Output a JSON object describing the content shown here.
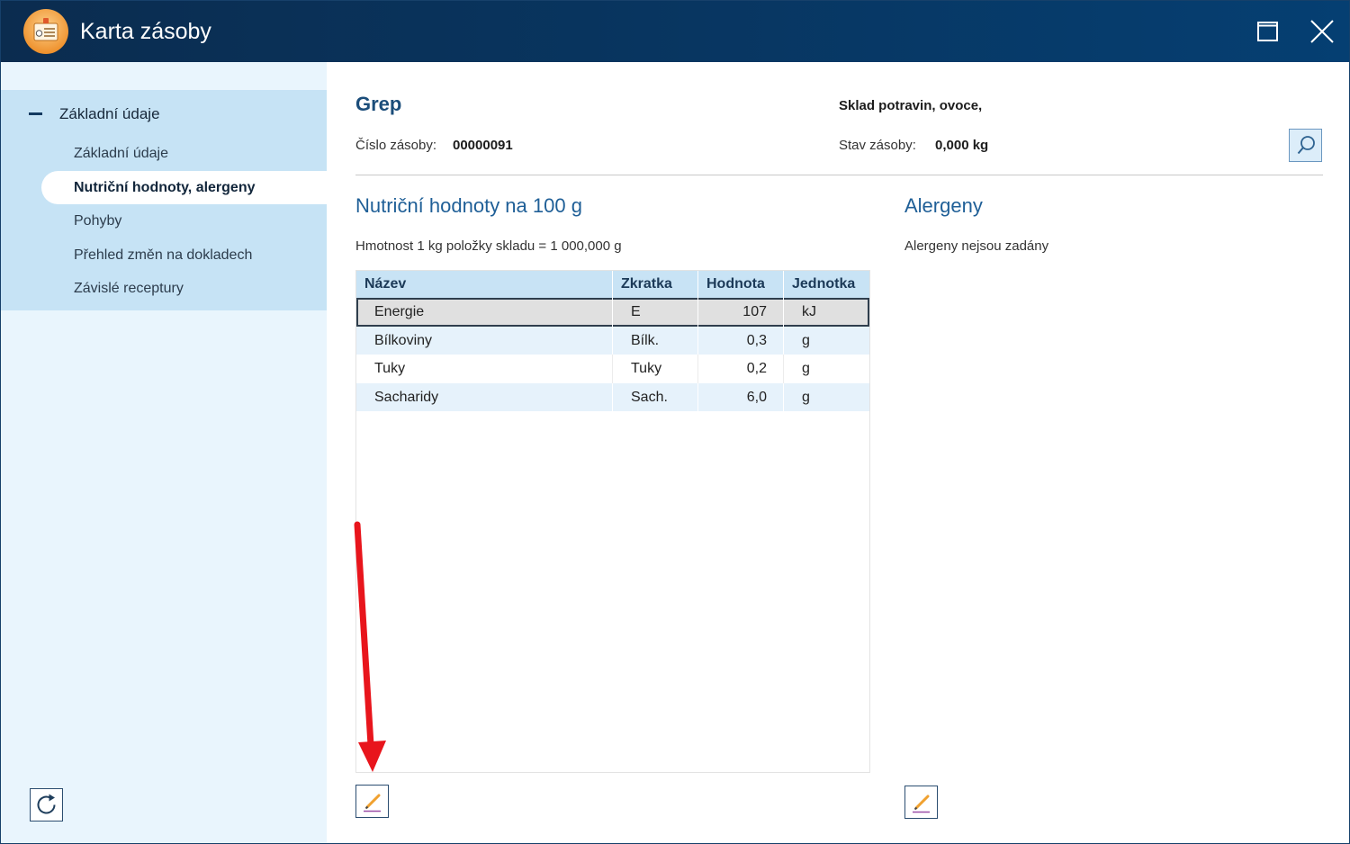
{
  "window": {
    "title": "Karta zásoby",
    "app_icon": "inventory-card-icon",
    "maximize_icon": "maximize-icon",
    "close_icon": "close-icon"
  },
  "sidebar": {
    "group": {
      "label": "Základní údaje",
      "toggle_icon": "minus-icon",
      "expanded": true
    },
    "items": [
      {
        "label": "Základní údaje"
      },
      {
        "label": "Nutriční hodnoty, alergeny",
        "selected": true
      },
      {
        "label": "Pohyby"
      },
      {
        "label": "Přehled změn na dokladech"
      },
      {
        "label": "Závislé receptury"
      }
    ],
    "refresh_icon": "refresh-icon"
  },
  "header": {
    "item_name": "Grep",
    "warehouse": "Sklad potravin, ovoce,",
    "stock_number_label": "Číslo zásoby:",
    "stock_number": "00000091",
    "stock_state_label": "Stav zásoby:",
    "stock_state": "0,000 kg",
    "search_icon": "search-icon"
  },
  "nutrition": {
    "title": "Nutriční hodnoty na 100 g",
    "weight_note": "Hmotnost 1 kg položky skladu = 1 000,000 g",
    "columns": [
      "Název",
      "Zkratka",
      "Hodnota",
      "Jednotka"
    ],
    "rows": [
      {
        "name": "Energie",
        "abbr": "E",
        "value": "107",
        "unit": "kJ",
        "selected": true
      },
      {
        "name": "Bílkoviny",
        "abbr": "Bílk.",
        "value": "0,3",
        "unit": "g"
      },
      {
        "name": "Tuky",
        "abbr": "Tuky",
        "value": "0,2",
        "unit": "g"
      },
      {
        "name": "Sacharidy",
        "abbr": "Sach.",
        "value": "6,0",
        "unit": "g"
      }
    ],
    "edit_icon": "pencil-icon"
  },
  "allergens": {
    "title": "Alergeny",
    "empty_text": "Alergeny nejsou zadány",
    "edit_icon": "pencil-icon"
  },
  "colors": {
    "titlebar-start": "#0b2c4f",
    "titlebar-end": "#053f72",
    "sidebar-bg": "#e9f5fd",
    "nav-group-bg": "#c6e3f5",
    "heading-blue": "#1f5f97",
    "item-name-blue": "#1b4d7a",
    "table-header-bg": "#c8e3f5",
    "row-alt-bg": "#e6f2fb",
    "selected-row-bg": "#e0e0e0",
    "annotation-red": "#e8151c"
  }
}
